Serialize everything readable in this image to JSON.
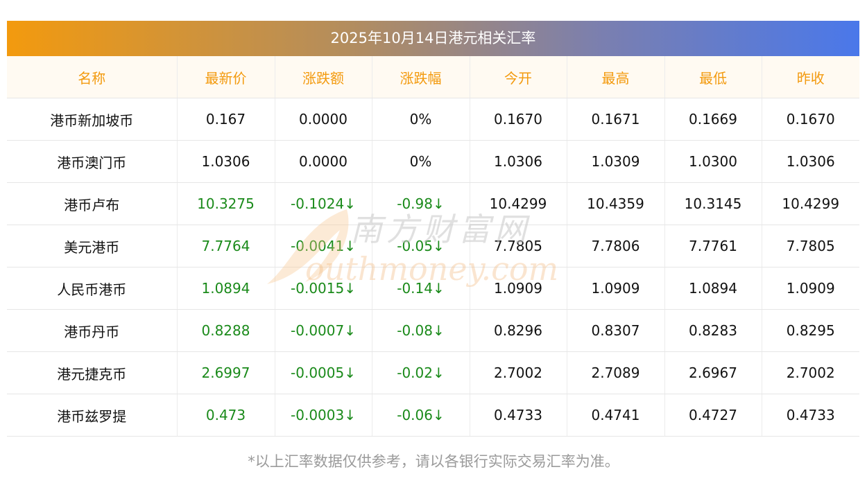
{
  "title": "2025年10月14日港元相关汇率",
  "columns": [
    "名称",
    "最新价",
    "涨跌额",
    "涨跌幅",
    "今开",
    "最高",
    "最低",
    "昨收"
  ],
  "rows": [
    {
      "name": "港币新加坡币",
      "latest": "0.167",
      "change": "0.0000",
      "pct": "0%",
      "open": "0.1670",
      "high": "0.1671",
      "low": "0.1669",
      "prev": "0.1670",
      "down": false
    },
    {
      "name": "港币澳门币",
      "latest": "1.0306",
      "change": "0.0000",
      "pct": "0%",
      "open": "1.0306",
      "high": "1.0309",
      "low": "1.0300",
      "prev": "1.0306",
      "down": false
    },
    {
      "name": "港币卢布",
      "latest": "10.3275",
      "change": "-0.1024↓",
      "pct": "-0.98↓",
      "open": "10.4299",
      "high": "10.4359",
      "low": "10.3145",
      "prev": "10.4299",
      "down": true
    },
    {
      "name": "美元港币",
      "latest": "7.7764",
      "change": "-0.0041↓",
      "pct": "-0.05↓",
      "open": "7.7805",
      "high": "7.7806",
      "low": "7.7761",
      "prev": "7.7805",
      "down": true
    },
    {
      "name": "人民币港币",
      "latest": "1.0894",
      "change": "-0.0015↓",
      "pct": "-0.14↓",
      "open": "1.0909",
      "high": "1.0909",
      "low": "1.0894",
      "prev": "1.0909",
      "down": true
    },
    {
      "name": "港币丹币",
      "latest": "0.8288",
      "change": "-0.0007↓",
      "pct": "-0.08↓",
      "open": "0.8296",
      "high": "0.8307",
      "low": "0.8283",
      "prev": "0.8295",
      "down": true
    },
    {
      "name": "港元捷克币",
      "latest": "2.6997",
      "change": "-0.0005↓",
      "pct": "-0.02↓",
      "open": "2.7002",
      "high": "2.7089",
      "low": "2.6967",
      "prev": "2.7002",
      "down": true
    },
    {
      "name": "港币兹罗提",
      "latest": "0.473",
      "change": "-0.0003↓",
      "pct": "-0.06↓",
      "open": "0.4733",
      "high": "0.4741",
      "low": "0.4727",
      "prev": "0.4733",
      "down": true
    }
  ],
  "footnote": "*以上汇率数据仅供参考，请以各银行实际交易汇率为准。",
  "watermark": {
    "cn": "南方财富网",
    "en": "outhmoney.com"
  },
  "colors": {
    "header_text": "#f39a0e",
    "down": "#1a8a1a",
    "gradient_start": "#f39a0e",
    "gradient_end": "#4a78ea"
  }
}
